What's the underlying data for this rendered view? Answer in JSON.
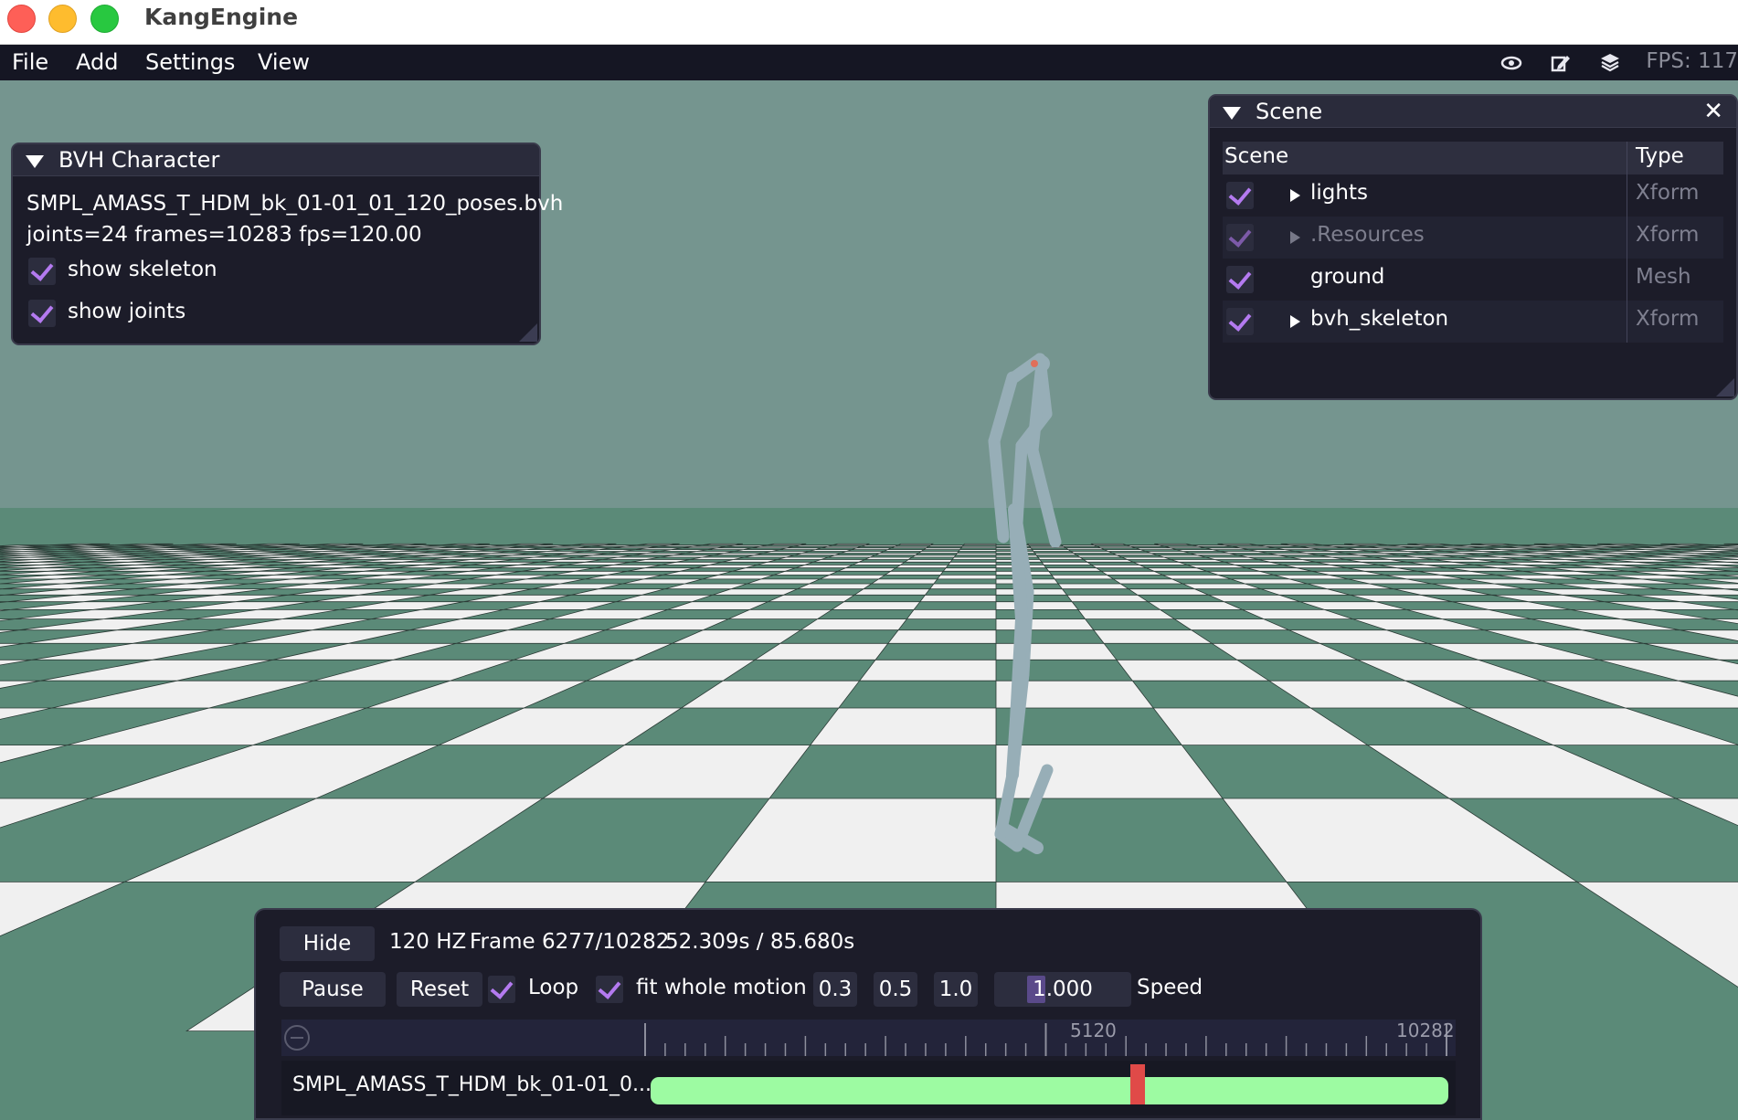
{
  "window": {
    "title": "KangEngine"
  },
  "menu": {
    "items": [
      "File",
      "Add",
      "Settings",
      "View"
    ],
    "icons": [
      "eye-icon",
      "edit-icon",
      "layers-icon"
    ],
    "fps": "FPS: 117"
  },
  "bvh_panel": {
    "title": "BVH Character",
    "filename": "SMPL_AMASS_T_HDM_bk_01-01_01_120_poses.bvh",
    "info": "joints=24 frames=10283 fps=120.00",
    "show_skeleton_label": "show skeleton",
    "show_skeleton_checked": true,
    "show_joints_label": "show joints",
    "show_joints_checked": true
  },
  "scene_panel": {
    "title": "Scene",
    "close_label": "✕",
    "columns": [
      "Scene",
      "Type"
    ],
    "rows": [
      {
        "name": "lights",
        "type": "Xform",
        "expandable": true,
        "dimmed": false
      },
      {
        "name": ".Resources",
        "type": "Xform",
        "expandable": true,
        "dimmed": true
      },
      {
        "name": "ground",
        "type": "Mesh",
        "expandable": false,
        "dimmed": false
      },
      {
        "name": "bvh_skeleton",
        "type": "Xform",
        "expandable": true,
        "dimmed": false
      }
    ]
  },
  "timeline": {
    "hide_label": "Hide",
    "rate": "120 HZ",
    "frame_text": "Frame 6277/10282",
    "time_text": "52.309s / 85.680s",
    "pause_label": "Pause",
    "reset_label": "Reset",
    "loop_label": "Loop",
    "fit_label": "fit whole motion",
    "speed_presets": [
      "0.3",
      "0.5",
      "1.0"
    ],
    "speed_value": "1.000",
    "speed_label": "Speed",
    "ruler_labels": [
      "5120",
      "10282"
    ],
    "track_name": "SMPL_AMASS_T_HDM_bk_01-01_0...",
    "current_frame": 6277,
    "total_frames": 10282
  },
  "colors": {
    "sky": "#75958f",
    "floor_dark": "#5b8a78",
    "floor_light": "#f0f0f0",
    "accent_check": "#b47af0",
    "track_green": "#9dfba2",
    "playhead_red": "#e04a48"
  }
}
